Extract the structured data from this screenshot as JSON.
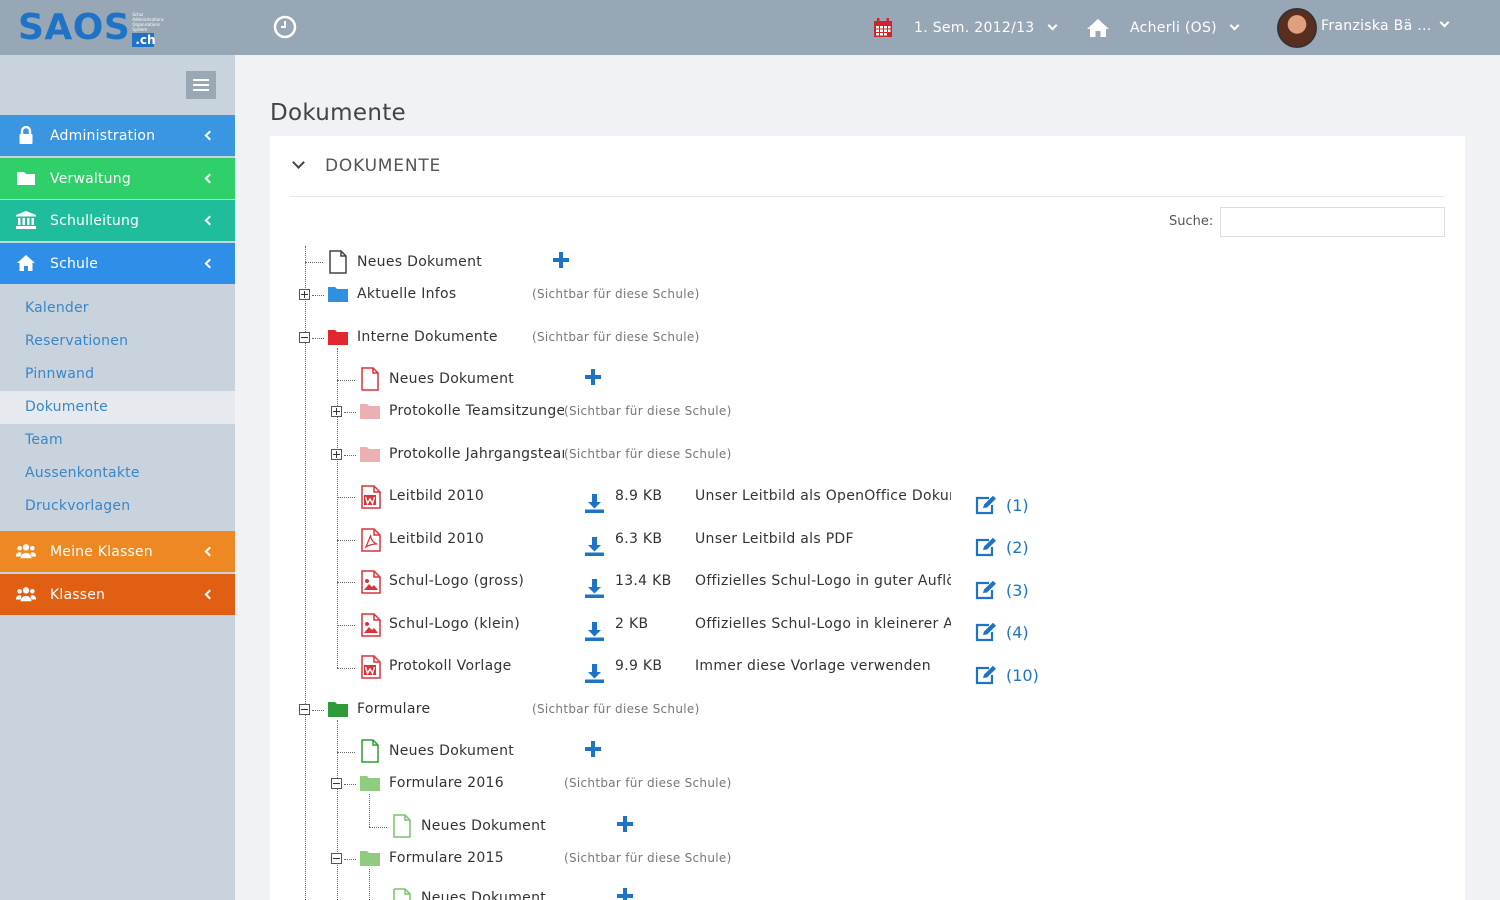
{
  "header": {
    "logo_main": "SAOS",
    "logo_small": "Schul Administrations Organisations System",
    "logo_suffix": ".ch",
    "semester": "1. Sem. 2012/13",
    "school": "Acherli (OS)",
    "user": "Franziska Bä ..."
  },
  "sidebar": {
    "menu": [
      {
        "label": "Administration",
        "color": "#3a96e0"
      },
      {
        "label": "Verwaltung",
        "color": "#2fcf6a"
      },
      {
        "label": "Schulleitung",
        "color": "#1fbd9b"
      },
      {
        "label": "Schule",
        "color": "#2f8ee8"
      },
      {
        "label": "Meine Klassen",
        "color": "#ee8822"
      },
      {
        "label": "Klassen",
        "color": "#e05f12"
      }
    ],
    "subitems": [
      "Kalender",
      "Reservationen",
      "Pinnwand",
      "Dokumente",
      "Team",
      "Aussenkontakte",
      "Druckvorlagen"
    ]
  },
  "main": {
    "page_title": "Dokumente",
    "panel_title": "DOKUMENTE",
    "search_label": "Suche:",
    "search_value": "",
    "visibility_text": "(Sichtbar für diese Schule)",
    "new_document": "Neues Dokument",
    "tree": {
      "root_new": "Neues Dokument",
      "aktuelle_infos": "Aktuelle Infos",
      "interne_dokumente": "Interne Dokumente",
      "interne_new": "Neues Dokument",
      "protokolle_team": "Protokolle Teamsitzungen",
      "protokolle_jahr": "Protokolle Jahrgangsteams",
      "files": [
        {
          "name": "Leitbild 2010",
          "type": "word",
          "size": "8.9 KB",
          "desc": "Unser Leitbild als OpenOffice Dokument",
          "ref": "(1)"
        },
        {
          "name": "Leitbild 2010",
          "type": "pdf",
          "size": "6.3 KB",
          "desc": "Unser Leitbild als PDF",
          "ref": "(2)"
        },
        {
          "name": "Schul-Logo (gross)",
          "type": "image",
          "size": "13.4 KB",
          "desc": "Offizielles Schul-Logo in guter Auflösung",
          "ref": "(3)"
        },
        {
          "name": "Schul-Logo (klein)",
          "type": "image",
          "size": "2 KB",
          "desc": "Offizielles Schul-Logo in kleinerer Auflösung",
          "ref": "(4)"
        },
        {
          "name": "Protokoll Vorlage",
          "type": "word",
          "size": "9.9 KB",
          "desc": "Immer diese Vorlage verwenden",
          "ref": "(10)"
        }
      ],
      "formulare": "Formulare",
      "formulare_new": "Neues Dokument",
      "formulare_2016": "Formulare 2016",
      "formulare_2016_new": "Neues Dokument",
      "formulare_2015": "Formulare 2015",
      "formulare_2015_new": "Neues Dokument"
    }
  },
  "colors": {
    "blue_folder": "#2f8fe0",
    "red_folder": "#e0262e",
    "pink_folder": "#eab0b2",
    "green_folder": "#2e9a3a",
    "light_green_folder": "#8fcc7e",
    "accent": "#1f73c7"
  }
}
